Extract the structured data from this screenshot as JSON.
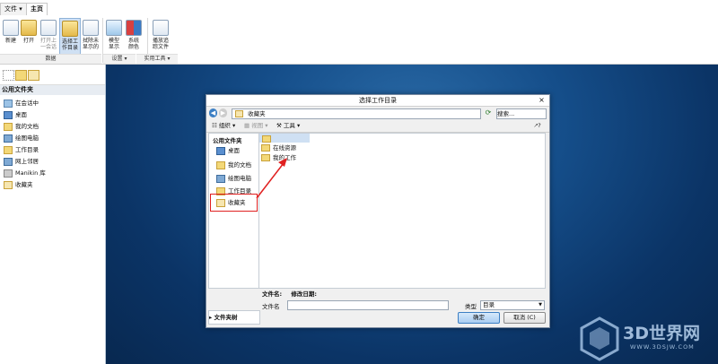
{
  "menu": {
    "file_tab": "文件 ▾",
    "home_tab": "主页"
  },
  "ribbon": {
    "buttons": [
      "新建",
      "打开",
      "打开上一会话",
      "选择工作目录",
      "拭除未显示的",
      "模型显示",
      "系统颜色",
      "播放追踪文件"
    ],
    "buttons_lines": [
      [
        "新建"
      ],
      [
        "打开"
      ],
      [
        "打开上",
        "一会话"
      ],
      [
        "选择工",
        "作目录"
      ],
      [
        "拭除未",
        "显示的"
      ],
      [
        "模型",
        "显示"
      ],
      [
        "系统",
        "颜色"
      ],
      [
        "播放追",
        "踪文件"
      ]
    ],
    "groups": {
      "data": "数据",
      "settings": "设置 ▾",
      "utilities": "实用工具 ▾"
    }
  },
  "left_panel": {
    "header": "公用文件夹",
    "items": [
      "在会话中",
      "桌面",
      "我的文档",
      "绘图电脑",
      "工作目录",
      "网上邻居",
      "Manikin 库",
      "收藏夹"
    ]
  },
  "dialog": {
    "title": "选择工作目录",
    "close": "×",
    "address": "收藏夹",
    "search_placeholder": "搜索...",
    "toolbar": {
      "organize": "组织 ▾",
      "views": "视图 ▾",
      "tools": "工具 ▾",
      "help": "🡕?"
    },
    "side_header": "公用文件夹",
    "side_items": [
      "桌面",
      "我的文档",
      "绘图电脑",
      "工作目录",
      "收藏夹"
    ],
    "files": [
      "在线资源",
      "我的工作"
    ],
    "columns": {
      "name": "文件名:",
      "modified": "修改日期:"
    },
    "file_name_label": "文件名",
    "type_label": "类型",
    "type_value": "目录",
    "tree": "▸ 文件夹树",
    "ok": "确定",
    "cancel": "取消 (C)"
  },
  "watermark": {
    "text": "3D世界网",
    "url": "WWW.3DSJW.COM"
  },
  "colors": {
    "accent": "#1a5a96",
    "highlight": "#e02020",
    "desktop": "#0b3466"
  }
}
